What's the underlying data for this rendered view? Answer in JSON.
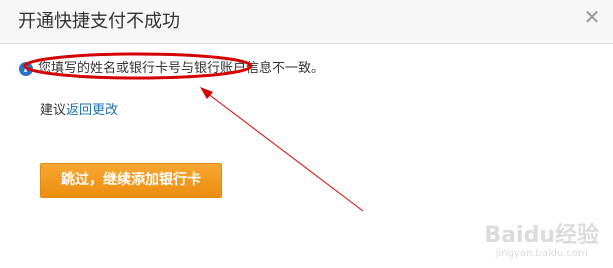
{
  "dialog": {
    "title": "开通快捷支付不成功",
    "close_icon": "close-icon",
    "message": "您填写的姓名或银行卡号与银行账户信息不一致。",
    "info_icon": "info-icon",
    "suggest_prefix": "建议",
    "suggest_link": "返回更改",
    "primary_button": "跳过，继续添加银行卡"
  },
  "annotation": {
    "color": "#d40000"
  },
  "watermark": {
    "logo": "Baidu经验",
    "url": "jingyan.baidu.com"
  },
  "colors": {
    "accent_button": "#f09a1f",
    "link": "#1a6fb5",
    "info": "#2a74c4"
  }
}
